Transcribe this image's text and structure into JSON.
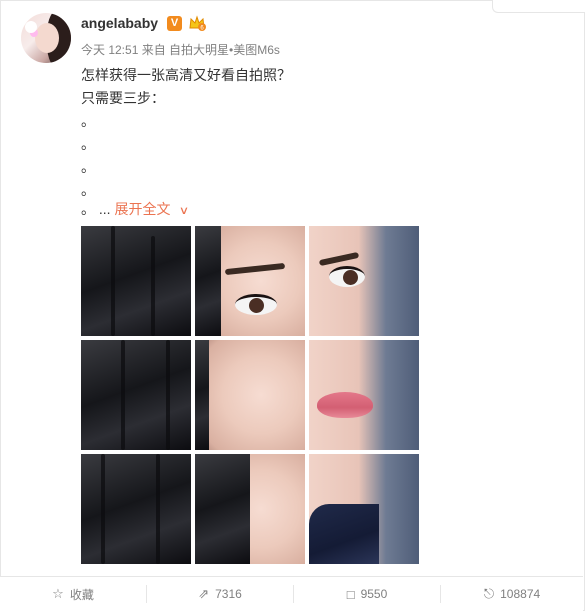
{
  "post": {
    "author": "angelababy",
    "verified_badge": "V",
    "meta": "今天 12:51 来自 自拍大明星•美图M6s",
    "line1": "怎样获得一张高清又好看自拍照？",
    "line2": "只需要三步：",
    "dots": [
      "。",
      "。",
      "。",
      "。",
      "。"
    ],
    "ellipsis": "...",
    "expand_label": "展开全文",
    "expand_icon": "chevron-down-icon"
  },
  "actions": {
    "favorite_label": "收藏",
    "repost_count": "7316",
    "comment_count": "9550",
    "like_count": "108874"
  },
  "colors": {
    "accent": "#eb7350",
    "muted": "#808080",
    "badge": "#f28b1e"
  }
}
